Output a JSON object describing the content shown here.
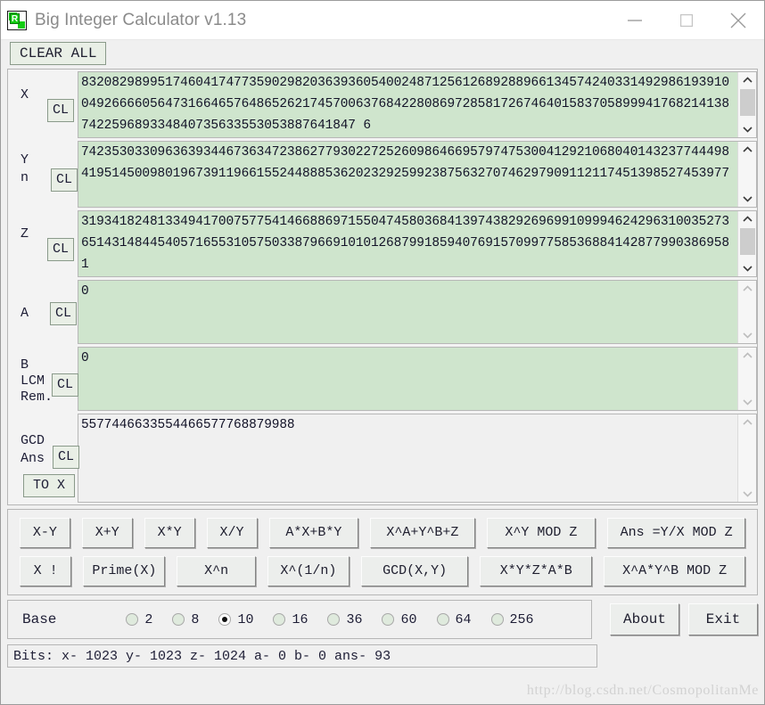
{
  "window": {
    "title": "Big Integer Calculator v1.13",
    "icon": "app-icon",
    "minimize_label": "minimize-icon",
    "maximize_label": "maximize-icon",
    "close_label": "close-icon"
  },
  "toolbar": {
    "clear_all_label": "CLEAR ALL"
  },
  "fields": [
    {
      "id": "x",
      "labels": [
        "X"
      ],
      "cl_label": "CL",
      "value": "83208298995174604174773590298203639360540024871256126892889661345742403314929861939100492666605647316646576486526217457006376842280869728581726746401583705899941768214138742259689334840735633553053887641847 6",
      "readonly": false,
      "scroll_thumb": true
    },
    {
      "id": "yn",
      "labels": [
        "Y",
        "n"
      ],
      "cl_label": "CL",
      "value": "74235303309636393446736347238627793022725260986466957974753004129210680401432377444984195145009801967391196615524488853620232925992387563270746297909112117451398527453977",
      "readonly": false,
      "scroll_thumb": false
    },
    {
      "id": "z",
      "labels": [
        "Z"
      ],
      "cl_label": "CL",
      "value": "31934182481334941700757754146688697155047458036841397438292696991099946242963100352736514314844540571655310575033879669101012687991859407691570997758536884142877990386958 1",
      "readonly": false,
      "scroll_thumb": true
    },
    {
      "id": "a",
      "labels": [
        "A"
      ],
      "cl_label": "CL",
      "value": "0",
      "readonly": false,
      "scroll_thumb": false
    },
    {
      "id": "b",
      "labels": [
        "B",
        "LCM",
        "Rem."
      ],
      "cl_label": "CL",
      "value": "0",
      "readonly": false,
      "scroll_thumb": false
    },
    {
      "id": "gcd",
      "labels": [
        "GCD",
        "Ans"
      ],
      "cl_label": "CL",
      "to_x_label": "TO X",
      "value": "5577446633554466577768879988",
      "readonly": true,
      "scroll_thumb": false
    }
  ],
  "operations": {
    "row1": [
      "X-Y",
      "X+Y",
      "X*Y",
      "X/Y",
      "A*X+B*Y",
      "X^A+Y^B+Z",
      "X^Y MOD Z",
      "Ans =Y/X MOD Z"
    ],
    "row2": [
      "X !",
      "Prime(X)",
      "X^n",
      "X^(1/n)",
      "GCD(X,Y)",
      "X*Y*Z*A*B",
      "X^A*Y^B MOD Z"
    ]
  },
  "base": {
    "label": "Base",
    "options": [
      "2",
      "8",
      "10",
      "16",
      "36",
      "60",
      "64",
      "256"
    ],
    "selected": "10",
    "about_label": "About",
    "exit_label": "Exit"
  },
  "status": {
    "text": "Bits: x- 1023 y- 1023 z- 1024 a- 0 b- 0 ans- 93",
    "bits": {
      "x": "1023",
      "y": "1023",
      "z": "1024",
      "a": "0",
      "b": "0",
      "ans": "93"
    }
  },
  "watermark": {
    "text": "http://blog.csdn.net/CosmopolitanMe"
  },
  "colors": {
    "field_background": "#cfe5cd",
    "readonly_background": "#f0f0f0",
    "window_background": "#f0f0f0",
    "accent_icon_green": "#12cc12",
    "text": "#1d1d35"
  }
}
